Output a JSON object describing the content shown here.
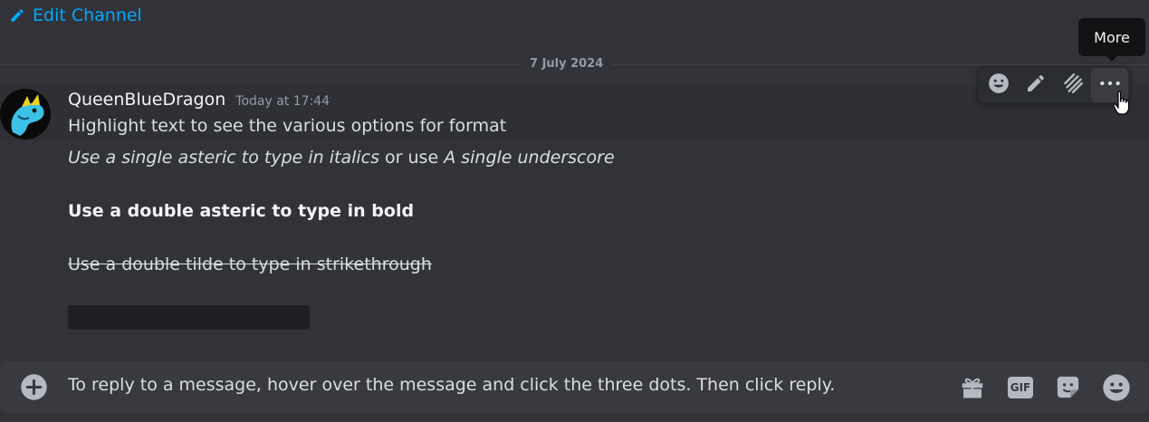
{
  "header": {
    "edit_channel_label": "Edit Channel"
  },
  "divider": {
    "date": "7 July 2024"
  },
  "message": {
    "author": "QueenBlueDragon",
    "timestamp": "Today at 17:44",
    "line1": "Highlight text to see the various options for format",
    "line2_italic_a": "Use a single asteric to type in italics",
    "line2_plain": " or use ",
    "line2_italic_b": "A single underscore",
    "line3_bold": "Use a double asteric to type in bold",
    "line4_strike": "Use a double tilde to type in strikethrough"
  },
  "toolbar": {
    "items": [
      "emoji-reaction",
      "edit",
      "thread",
      "more"
    ],
    "tooltip": "More"
  },
  "composer": {
    "placeholder": "To reply to a message, hover over the message and click the three dots. Then click reply.",
    "gif_label": "GIF"
  },
  "colors": {
    "link": "#00a8fc",
    "background": "#313338",
    "composer": "#383a40"
  }
}
